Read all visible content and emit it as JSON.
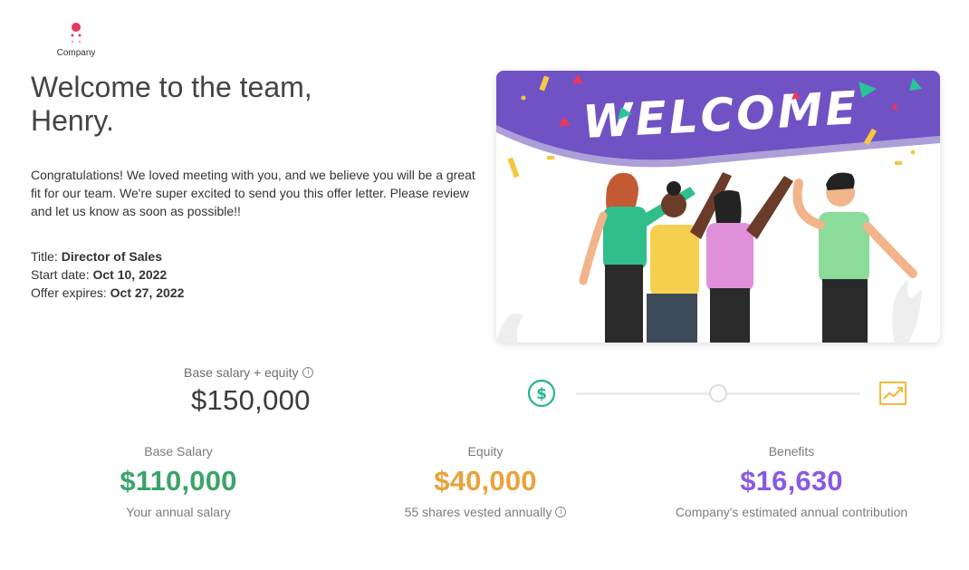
{
  "brand": {
    "name": "Company",
    "accent": "#e8385f"
  },
  "welcome": {
    "line1": "Welcome to the team,",
    "line2": "Henry.",
    "message": "Congratulations! We loved meeting with you, and we believe you will be a great fit for our team. We're super excited to send you this offer letter. Please review and let us know as soon as possible!!"
  },
  "offer": {
    "title_label": "Title:",
    "title_value": "Director of Sales",
    "start_label": "Start date:",
    "start_value": "Oct 10, 2022",
    "expires_label": "Offer expires:",
    "expires_value": "Oct 27, 2022"
  },
  "hero": {
    "banner_text": "WELCOME",
    "banner_color": "#7152c4"
  },
  "total": {
    "label": "Base salary + equity",
    "value": "$150,000",
    "info_icon": "info-icon"
  },
  "mix_slider": {
    "level": 0.5,
    "left_icon": "dollar-circle-icon",
    "right_icon": "trending-chart-icon"
  },
  "components": [
    {
      "label": "Base Salary",
      "value": "$110,000",
      "sub": "Your annual salary",
      "color": "#3ba46a",
      "has_info": false
    },
    {
      "label": "Equity",
      "value": "$40,000",
      "sub": "55 shares vested annually",
      "color": "#eba23a",
      "has_info": true
    },
    {
      "label": "Benefits",
      "value": "$16,630",
      "sub": "Company's estimated annual contribution",
      "color": "#8a5ae3",
      "has_info": false
    }
  ]
}
